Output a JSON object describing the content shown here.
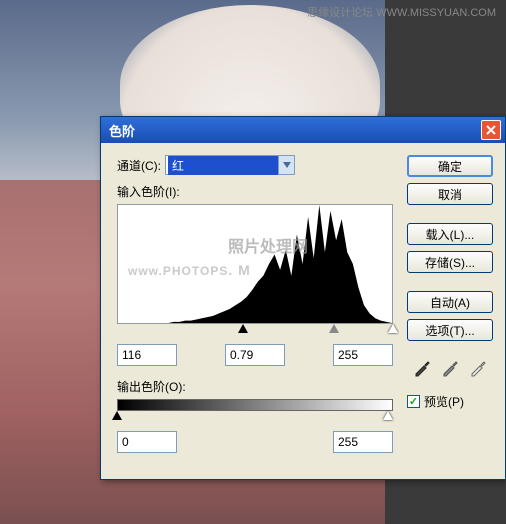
{
  "watermark": {
    "top_right": "思缘设计论坛  WWW.MISSYUAN.COM",
    "photops": "PHOTOPS",
    "photops_suffix": ".  M",
    "www": "www.",
    "cn": "照片处理网"
  },
  "dialog": {
    "title": "色阶",
    "channel_label": "通道(C):",
    "channel_value": "红",
    "input_label": "输入色阶(I):",
    "output_label": "输出色阶(O):",
    "input_values": {
      "shadow": "116",
      "gamma": "0.79",
      "highlight": "255"
    },
    "output_values": {
      "low": "0",
      "high": "255"
    },
    "buttons": {
      "ok": "确定",
      "cancel": "取消",
      "load": "载入(L)...",
      "save": "存储(S)...",
      "auto": "自动(A)",
      "options": "选项(T)..."
    },
    "preview_label": "预览(P)",
    "preview_checked": true
  },
  "chart_data": {
    "type": "histogram",
    "title": "输入色阶",
    "xrange": [
      0,
      255
    ],
    "sliders": {
      "shadow": 116,
      "gamma": 0.79,
      "highlight": 255
    },
    "bins_approx": [
      0,
      0,
      0,
      0,
      0,
      0,
      0,
      0,
      0,
      0,
      1,
      1,
      2,
      2,
      3,
      4,
      5,
      6,
      8,
      10,
      12,
      15,
      18,
      22,
      28,
      35,
      40,
      50,
      58,
      45,
      62,
      40,
      75,
      50,
      90,
      55,
      100,
      60,
      95,
      70,
      88,
      60,
      50,
      30,
      15,
      8,
      4,
      2,
      1,
      0
    ]
  }
}
